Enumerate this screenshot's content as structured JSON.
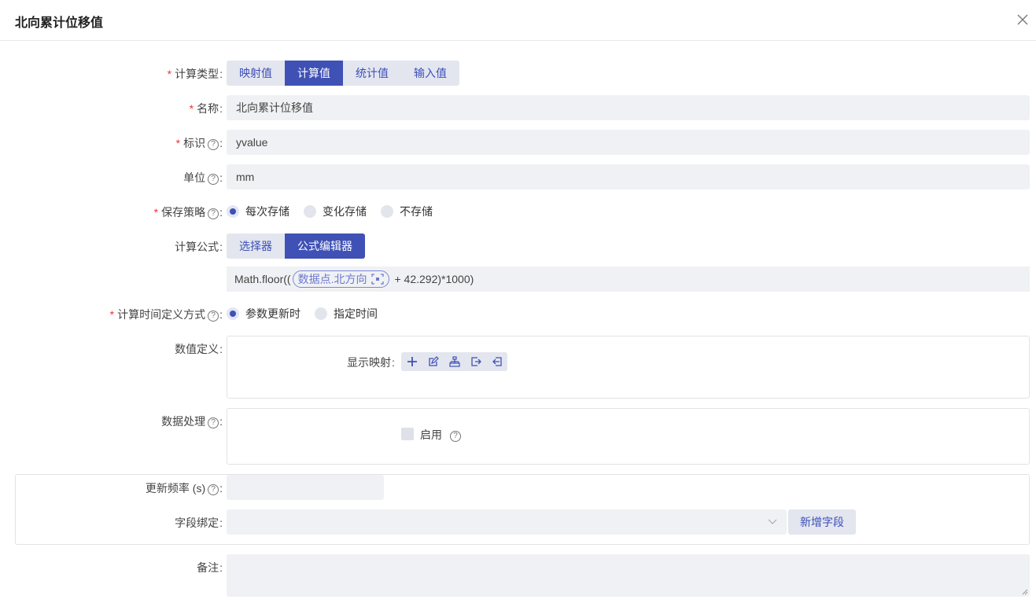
{
  "dialog": {
    "title": "北向累计位移值"
  },
  "form": {
    "calc_type": {
      "label": "计算类型",
      "options": [
        "映射值",
        "计算值",
        "统计值",
        "输入值"
      ],
      "selected": "计算值"
    },
    "name": {
      "label": "名称",
      "value": "北向累计位移值"
    },
    "identifier": {
      "label": "标识",
      "value": "yvalue"
    },
    "unit": {
      "label": "单位",
      "value": "mm"
    },
    "save_strategy": {
      "label": "保存策略",
      "options": [
        "每次存储",
        "变化存储",
        "不存储"
      ],
      "selected": "每次存储"
    },
    "formula": {
      "label": "计算公式",
      "tabs": [
        "选择器",
        "公式编辑器"
      ],
      "selected": "公式编辑器",
      "prefix": "Math.floor((",
      "chip": "数据点.北方向",
      "suffix": "+ 42.292)*1000)"
    },
    "time_def": {
      "label": "计算时间定义方式",
      "options": [
        "参数更新时",
        "指定时间"
      ],
      "selected": "参数更新时"
    },
    "value_def": {
      "label": "数值定义",
      "display_mapping_label": "显示映射"
    },
    "data_processing": {
      "label": "数据处理",
      "enable_label": "启用"
    },
    "update_freq": {
      "label": "更新频率 (s)",
      "value": ""
    },
    "field_binding": {
      "label": "字段绑定",
      "value": "",
      "add_button": "新增字段"
    },
    "remark": {
      "label": "备注",
      "value": ""
    }
  },
  "colors": {
    "primary": "#3f51b5",
    "required": "#e33333"
  }
}
